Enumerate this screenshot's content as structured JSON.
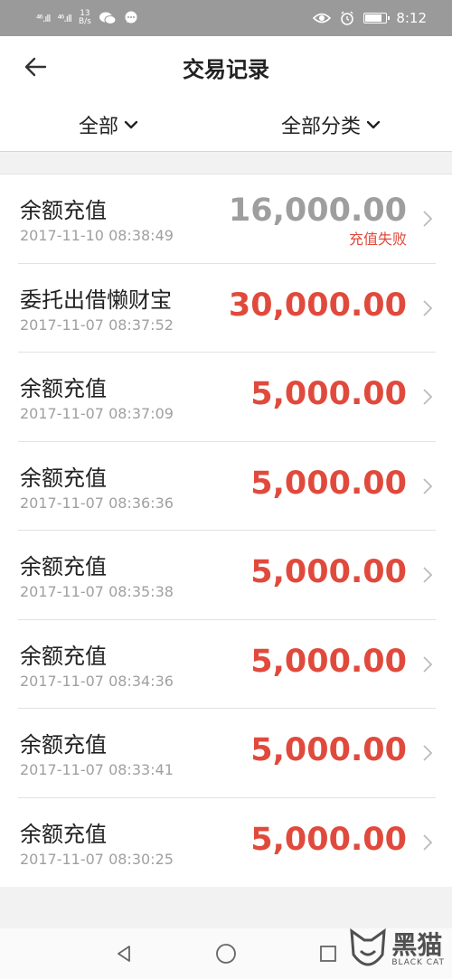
{
  "status_bar": {
    "signal1": "⁴⁶.ıll",
    "signal2": "⁴⁶.ıll",
    "speed_value": "13",
    "speed_unit": "B/s",
    "time": "8:12"
  },
  "header": {
    "title": "交易记录"
  },
  "filters": {
    "type_label": "全部",
    "category_label": "全部分类"
  },
  "transactions": [
    {
      "name": "余额充值",
      "date": "2017-11-10 08:38:49",
      "amount": "16,000.00",
      "status": "充值失败"
    },
    {
      "name": "委托出借懒财宝",
      "date": "2017-11-07 08:37:52",
      "amount": "30,000.00",
      "status": ""
    },
    {
      "name": "余额充值",
      "date": "2017-11-07 08:37:09",
      "amount": "5,000.00",
      "status": ""
    },
    {
      "name": "余额充值",
      "date": "2017-11-07 08:36:36",
      "amount": "5,000.00",
      "status": ""
    },
    {
      "name": "余额充值",
      "date": "2017-11-07 08:35:38",
      "amount": "5,000.00",
      "status": ""
    },
    {
      "name": "余额充值",
      "date": "2017-11-07 08:34:36",
      "amount": "5,000.00",
      "status": ""
    },
    {
      "name": "余额充值",
      "date": "2017-11-07 08:33:41",
      "amount": "5,000.00",
      "status": ""
    },
    {
      "name": "余额充值",
      "date": "2017-11-07 08:30:25",
      "amount": "5,000.00",
      "status": ""
    }
  ],
  "watermark": {
    "cn": "黑猫",
    "en": "BLACK CAT"
  },
  "colors": {
    "accent_red": "#e04a3c",
    "failed_gray": "#9e9e9e"
  }
}
